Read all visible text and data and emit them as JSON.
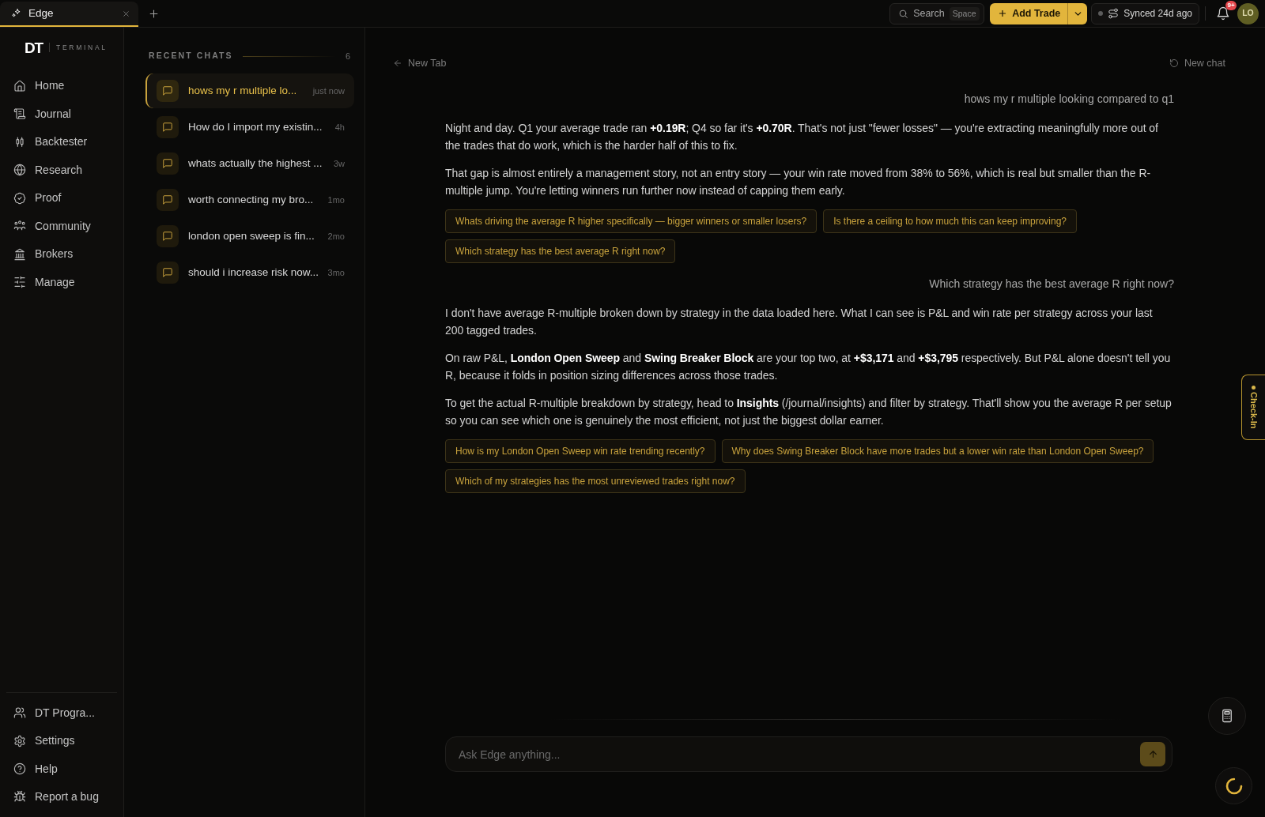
{
  "top_bar": {
    "tabs": [
      {
        "label": "Edge",
        "selected": true
      }
    ],
    "search": {
      "label": "Search",
      "shortcut": "Space"
    },
    "add_trade": {
      "label": "Add Trade"
    },
    "sync": {
      "label": "Synced 24d ago"
    },
    "notifications": {
      "badge": "9+"
    },
    "avatar": {
      "initials": "LO"
    }
  },
  "sidebar": {
    "logo": {
      "mark": "DT",
      "subtitle": "TERMINAL"
    },
    "items": [
      {
        "label": "Home",
        "selected": false
      },
      {
        "label": "Journal",
        "selected": false
      },
      {
        "label": "Backtester",
        "selected": false
      },
      {
        "label": "Research",
        "selected": false
      },
      {
        "label": "Proof",
        "selected": false
      },
      {
        "label": "Community",
        "selected": false
      },
      {
        "label": "Brokers",
        "selected": false
      },
      {
        "label": "Manage",
        "selected": false
      }
    ],
    "footer_items": [
      {
        "label": "DT Progra..."
      },
      {
        "label": "Settings"
      },
      {
        "label": "Help"
      },
      {
        "label": "Report a bug"
      }
    ]
  },
  "recent_chats": {
    "title": "RECENT CHATS",
    "count": "6",
    "items": [
      {
        "title": "hows my r multiple lo...",
        "time": "just now",
        "selected": true
      },
      {
        "title": "How do I import my existin...",
        "time": "4h",
        "selected": false
      },
      {
        "title": "whats actually the highest ...",
        "time": "3w",
        "selected": false
      },
      {
        "title": "worth connecting my bro...",
        "time": "1mo",
        "selected": false
      },
      {
        "title": "london open sweep is fin...",
        "time": "2mo",
        "selected": false
      },
      {
        "title": "should i increase risk now...",
        "time": "3mo",
        "selected": false
      }
    ]
  },
  "chat": {
    "back_link": {
      "label": "New Tab"
    },
    "new_chat": {
      "label": "New chat"
    },
    "messages": [
      {
        "kind": "user",
        "text": "hows my r multiple looking compared to q1"
      },
      {
        "kind": "assistant",
        "paragraphs": [
          "Night and day. Q1 your average trade ran **+0.19R**; Q4 so far it's **+0.70R**. That's not just \"fewer losses\" — you're extracting meaningfully more out of the trades that do work, which is the harder half of this to fix.",
          "That gap is almost entirely a management story, not an entry story — your win rate moved from 38% to 56%, which is real but smaller than the R-multiple jump. You're letting winners run further now instead of capping them early."
        ],
        "suggestions": [
          "Whats driving the average R higher specifically — bigger winners or smaller losers?",
          "Is there a ceiling to how much this can keep improving?",
          "Which strategy has the best average R right now?"
        ]
      },
      {
        "kind": "user",
        "text": "Which strategy has the best average R right now?"
      },
      {
        "kind": "assistant",
        "paragraphs": [
          "I don't have average R-multiple broken down by strategy in the data loaded here. What I can see is P&L and win rate per strategy across your last 200 tagged trades.",
          "On raw P&L, **London Open Sweep** and **Swing Breaker Block** are your top two, at **+$3,171** and **+$3,795** respectively. But P&L alone doesn't tell you R, because it folds in position sizing differences across those trades.",
          "To get the actual R-multiple breakdown by strategy, head to **Insights** (/journal/insights) and filter by strategy. That'll show you the average R per setup so you can see which one is genuinely the most efficient, not just the biggest dollar earner."
        ],
        "suggestions": [
          "How is my London Open Sweep win rate trending recently?",
          "Why does Swing Breaker Block have more trades but a lower win rate than London Open Sweep?",
          "Which of my strategies has the most unreviewed trades right now?"
        ]
      }
    ],
    "composer": {
      "placeholder": "Ask Edge anything..."
    }
  },
  "check_in": {
    "label": "Check-In"
  }
}
